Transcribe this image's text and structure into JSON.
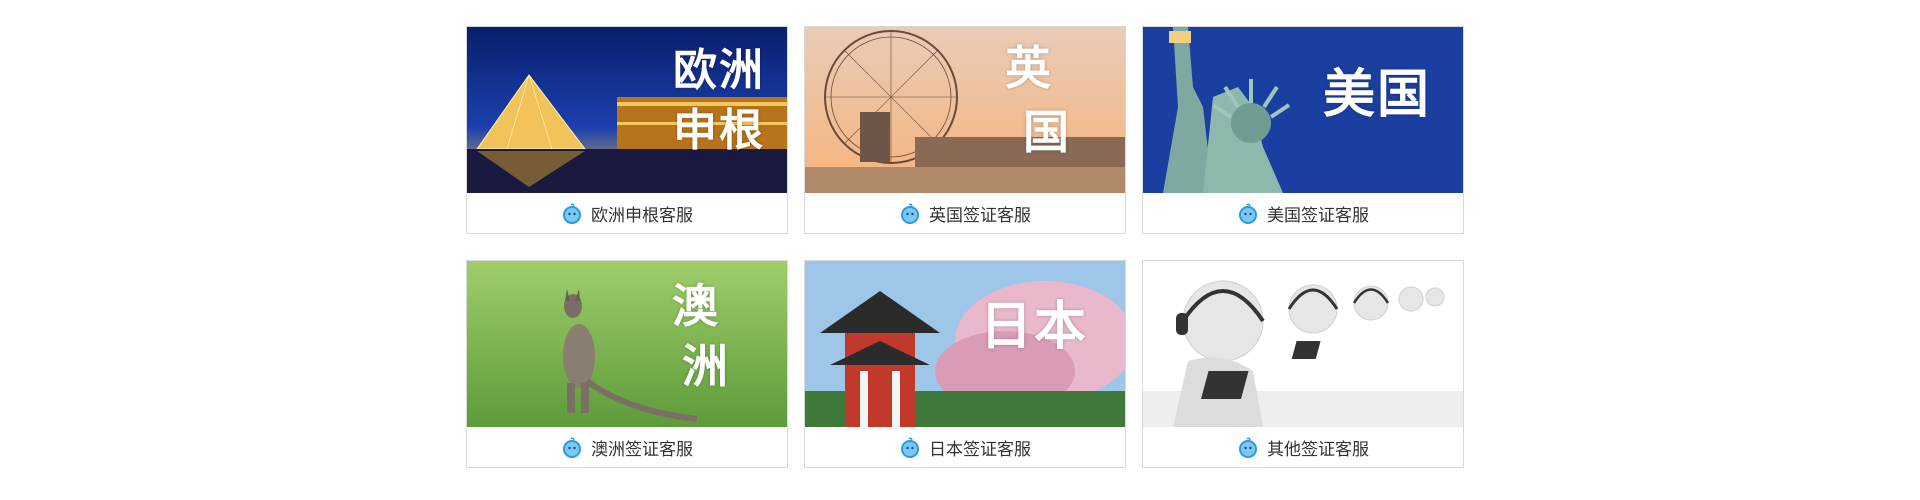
{
  "services": [
    {
      "label": "欧洲申根客服",
      "overlay": [
        "欧洲",
        "申根"
      ],
      "image": "louvre-pyramid-night"
    },
    {
      "label": "英国签证客服",
      "overlay": [
        "英",
        "国"
      ],
      "image": "london-eye-sunset"
    },
    {
      "label": "美国签证客服",
      "overlay": [
        "美国"
      ],
      "image": "statue-of-liberty"
    },
    {
      "label": "澳洲签证客服",
      "overlay": [
        "澳",
        "洲"
      ],
      "image": "kangaroo-on-grass"
    },
    {
      "label": "日本签证客服",
      "overlay": [
        "日本"
      ],
      "image": "japanese-temple-cherry-blossom"
    },
    {
      "label": "其他签证客服",
      "overlay": [],
      "image": "3d-figures-with-headsets"
    }
  ],
  "icon": "qq-chat-icon",
  "colors": {
    "card_border": "#d9d9d9",
    "caption_text": "#333333",
    "icon_blue": "#2a9be0"
  }
}
